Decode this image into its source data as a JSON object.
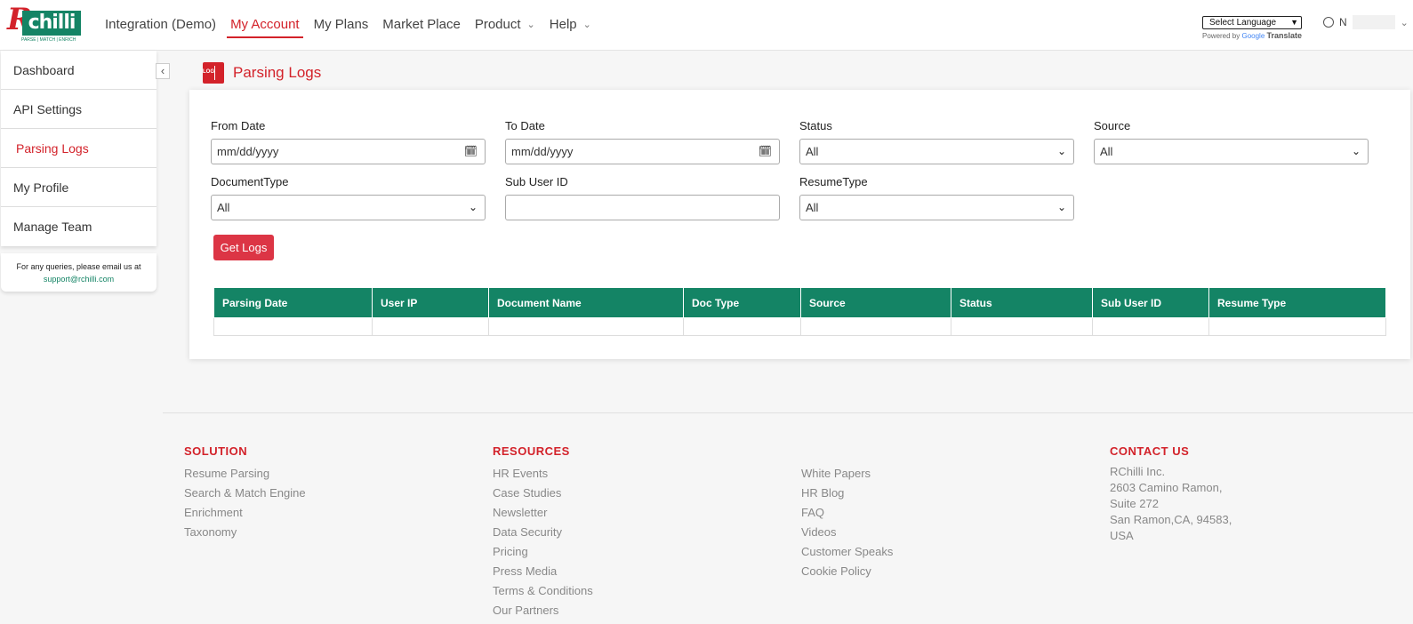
{
  "brand": {
    "logo_letter": "R",
    "logo_word": "chilli",
    "tagline": "PARSE | MATCH | ENRICH"
  },
  "nav": {
    "items": [
      {
        "label": "Integration (Demo)",
        "dropdown": false
      },
      {
        "label": "My Account",
        "dropdown": false,
        "active": true
      },
      {
        "label": "My Plans",
        "dropdown": false
      },
      {
        "label": "Market Place",
        "dropdown": false
      },
      {
        "label": "Product",
        "dropdown": true
      },
      {
        "label": "Help",
        "dropdown": true
      }
    ],
    "language_select": "Select Language",
    "powered_by": "Powered by",
    "google": "Google",
    "translate": "Translate",
    "user_initial": "N"
  },
  "sidebar": {
    "items": [
      "Dashboard",
      "API Settings",
      "Parsing Logs",
      "My Profile",
      "Manage Team"
    ],
    "active": "Parsing Logs",
    "query_text": "For any queries, please email us at",
    "query_email": "support@rchilli.com"
  },
  "page": {
    "title": "Parsing Logs",
    "icon_text": "LOG"
  },
  "filters": {
    "from_date": {
      "label": "From Date",
      "placeholder": "mm/dd/yyyy"
    },
    "to_date": {
      "label": "To Date",
      "placeholder": "mm/dd/yyyy"
    },
    "status": {
      "label": "Status",
      "value": "All"
    },
    "source": {
      "label": "Source",
      "value": "All"
    },
    "document_type": {
      "label": "DocumentType",
      "value": "All"
    },
    "sub_user_id": {
      "label": "Sub User ID",
      "value": ""
    },
    "resume_type": {
      "label": "ResumeType",
      "value": "All"
    },
    "get_logs": "Get Logs"
  },
  "table": {
    "headers": [
      "Parsing Date",
      "User IP",
      "Document Name",
      "Doc Type",
      "Source",
      "Status",
      "Sub User ID",
      "Resume Type"
    ],
    "rows": []
  },
  "footer": {
    "solution": {
      "heading": "SOLUTION",
      "links": [
        "Resume Parsing",
        "Search & Match Engine",
        "Enrichment",
        "Taxonomy"
      ]
    },
    "resources": {
      "heading": "RESOURCES",
      "links": [
        "HR Events",
        "Case Studies",
        "Newsletter",
        "Data Security",
        "Pricing",
        "Press Media",
        "Terms & Conditions",
        "Our Partners"
      ]
    },
    "resources2": {
      "links": [
        "White Papers",
        "HR Blog",
        "FAQ",
        "Videos",
        "Customer Speaks",
        "Cookie Policy"
      ]
    },
    "contact": {
      "heading": "CONTACT US",
      "lines": [
        "RChilli Inc.",
        "2603 Camino Ramon,",
        "Suite 272",
        "San Ramon,CA, 94583,",
        "USA"
      ]
    }
  },
  "colors": {
    "brand_red": "#d3222a",
    "brand_green": "#148465",
    "button_red": "#dc3545"
  }
}
